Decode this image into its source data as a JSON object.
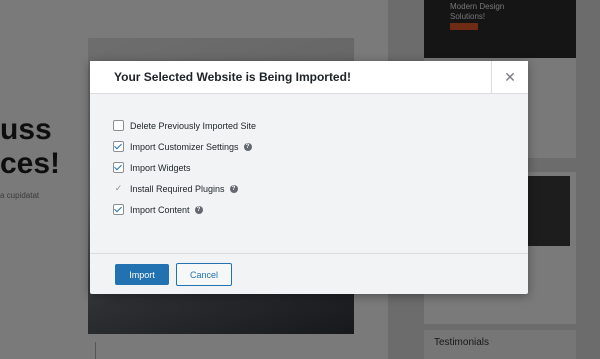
{
  "background": {
    "heading_line1": "uss",
    "heading_line2": "ces!",
    "subtext": "a cupidatat",
    "thumb_title_line1": "Modern Design",
    "thumb_title_line2": "Solutions!",
    "testimonials_label": "Testimonials"
  },
  "modal": {
    "title": "Your Selected Website is Being Imported!",
    "close_symbol": "✕",
    "options": [
      {
        "label": "Delete Previously Imported Site",
        "state": "unchecked",
        "help": false
      },
      {
        "label": "Import Customizer Settings",
        "state": "checked",
        "help": true
      },
      {
        "label": "Import Widgets",
        "state": "checked",
        "help": false
      },
      {
        "label": "Install Required Plugins",
        "state": "done",
        "help": true
      },
      {
        "label": "Import Content",
        "state": "checked",
        "help": true
      }
    ],
    "help_symbol": "?",
    "import_label": "Import",
    "cancel_label": "Cancel"
  },
  "colors": {
    "primary": "#2271b1",
    "overlay": "rgba(0,0,0,0.5)"
  }
}
